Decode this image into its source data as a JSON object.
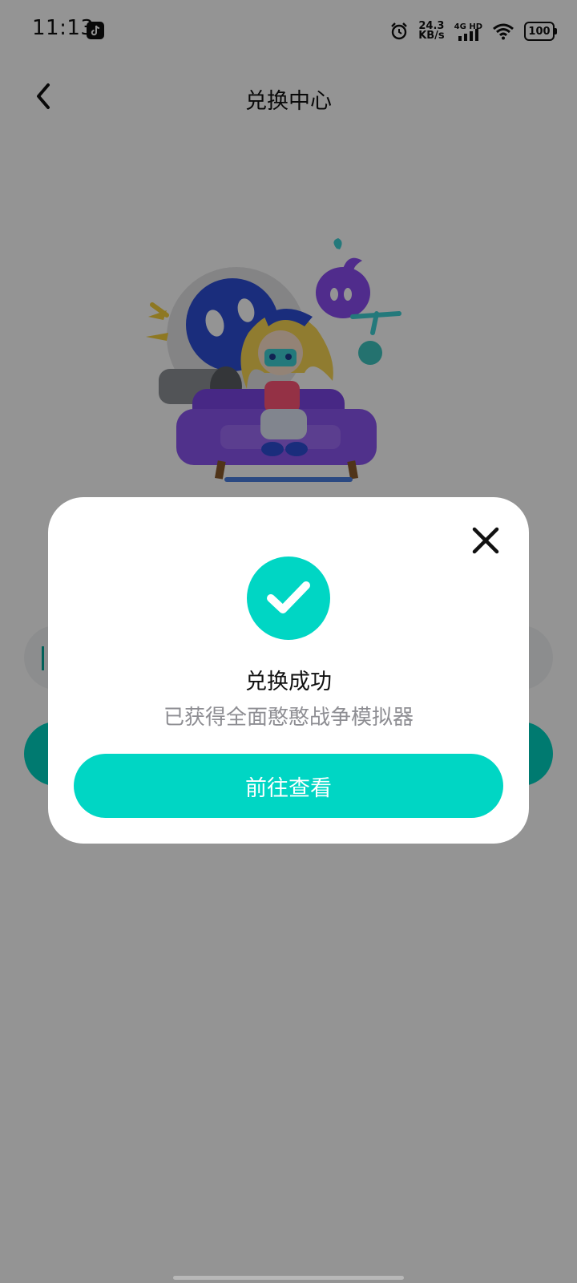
{
  "status_bar": {
    "time": "11:13",
    "network_speed_value": "24.3",
    "network_speed_unit": "KB/s",
    "network_mode": "4G HD",
    "battery": "100"
  },
  "header": {
    "title": "兑换中心"
  },
  "modal": {
    "title": "兑换成功",
    "subtitle": "已获得全面憨憨战争模拟器",
    "button_label": "前往查看"
  },
  "colors": {
    "accent": "#00d6c4",
    "overlay": "#000000",
    "subtitle_text": "#8e8e93"
  }
}
